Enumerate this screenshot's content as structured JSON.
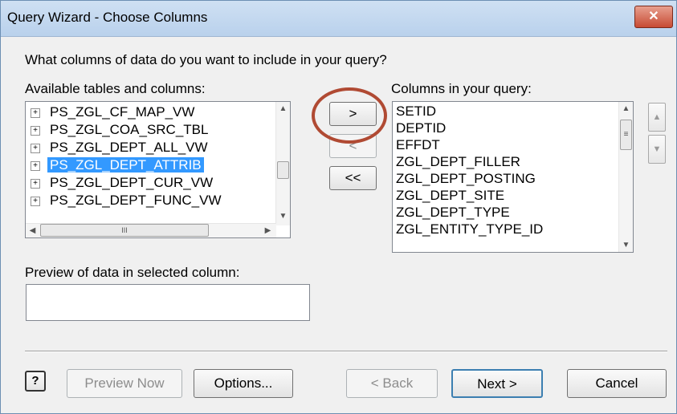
{
  "window": {
    "title": "Query Wizard - Choose Columns",
    "close_glyph": "✕"
  },
  "prompt": "What columns of data do you want to include in your query?",
  "available": {
    "label": "Available tables and columns:",
    "items": [
      {
        "label": "PS_ZGL_CF_MAP_VW",
        "selected": false
      },
      {
        "label": "PS_ZGL_COA_SRC_TBL",
        "selected": false
      },
      {
        "label": "PS_ZGL_DEPT_ALL_VW",
        "selected": false
      },
      {
        "label": "PS_ZGL_DEPT_ATTRIB",
        "selected": true
      },
      {
        "label": "PS_ZGL_DEPT_CUR_VW",
        "selected": false
      },
      {
        "label": "PS_ZGL_DEPT_FUNC_VW",
        "selected": false
      }
    ],
    "expand_glyph": "+"
  },
  "transfer": {
    "add_one": ">",
    "remove_one": "<",
    "remove_all": "<<"
  },
  "query_columns": {
    "label": "Columns in your query:",
    "items": [
      "SETID",
      "DEPTID",
      "EFFDT",
      "ZGL_DEPT_FILLER",
      "ZGL_DEPT_POSTING",
      "ZGL_DEPT_SITE",
      "ZGL_DEPT_TYPE",
      "ZGL_ENTITY_TYPE_ID"
    ]
  },
  "preview": {
    "label": "Preview of data in selected column:",
    "value": ""
  },
  "buttons": {
    "help": "?",
    "preview_now": "Preview Now",
    "options": "Options...",
    "back": "< Back",
    "next": "Next >",
    "cancel": "Cancel"
  },
  "scroll": {
    "up": "▲",
    "down": "▼",
    "left": "◀",
    "right": "▶",
    "grip": "≡",
    "hgrip": "III"
  },
  "annotation_color": "#b04a33"
}
